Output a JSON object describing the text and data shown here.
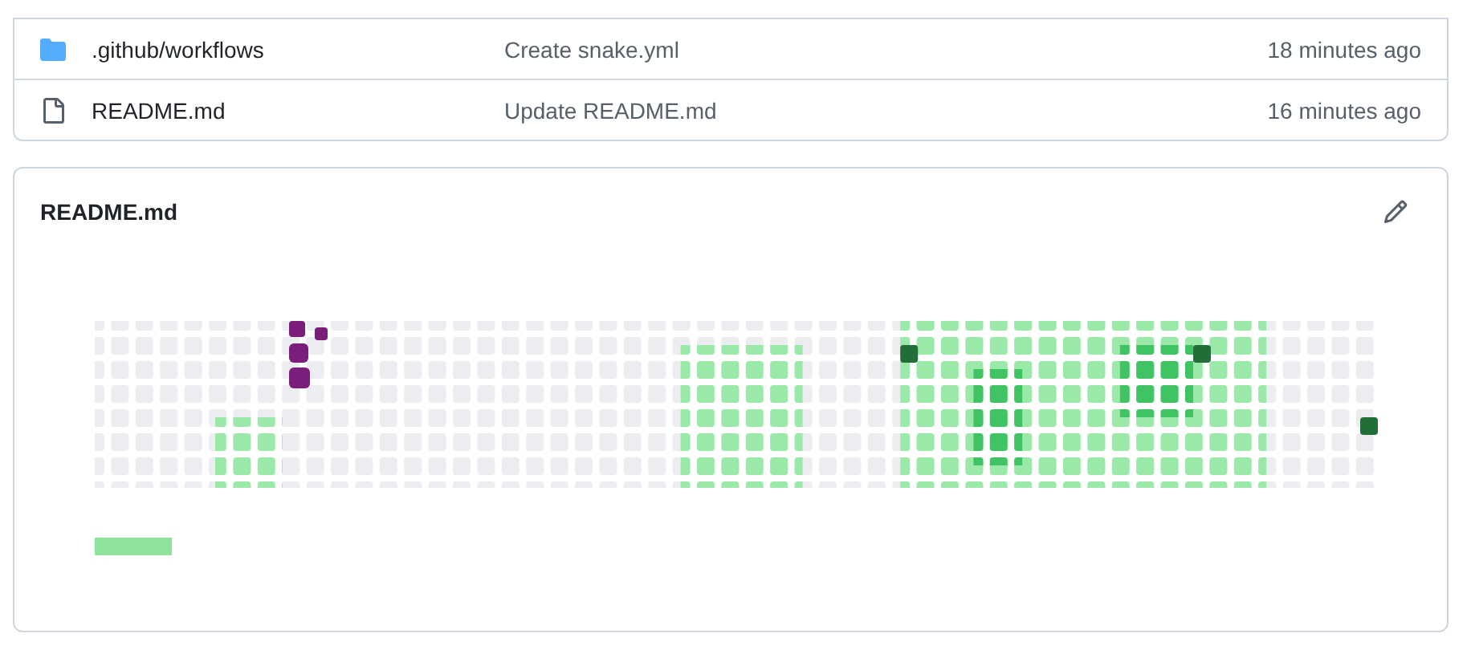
{
  "files": [
    {
      "kind": "folder",
      "name": ".github/workflows",
      "message": "Create snake.yml",
      "time": "18 minutes ago"
    },
    {
      "kind": "file",
      "name": "README.md",
      "message": "Update README.md",
      "time": "16 minutes ago"
    }
  ],
  "readme": {
    "title": "README.md"
  }
}
